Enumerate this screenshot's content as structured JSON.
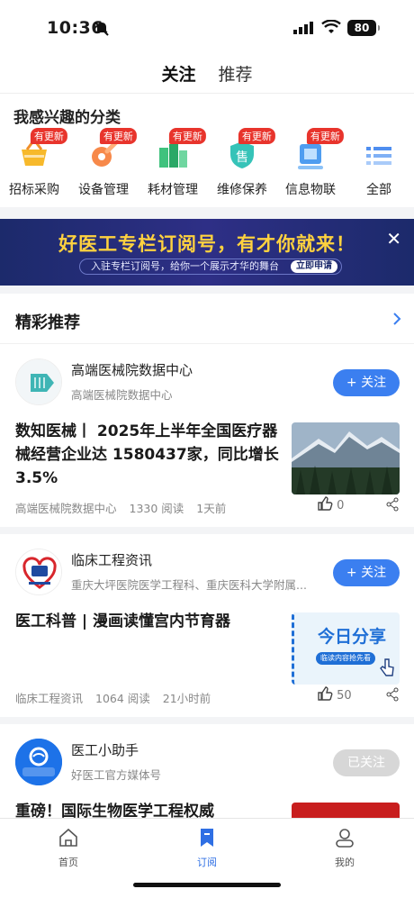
{
  "status_bar": {
    "time": "10:36",
    "battery": "80"
  },
  "top_tabs": {
    "follow": "关注",
    "recommend": "推荐"
  },
  "categories": {
    "title": "我感兴趣的分类",
    "badge": "有更新",
    "items": [
      {
        "label": "招标采购",
        "icon": "basket-icon",
        "badge": true
      },
      {
        "label": "设备管理",
        "icon": "wrench-gear-icon",
        "badge": true
      },
      {
        "label": "耗材管理",
        "icon": "boxes-icon",
        "badge": true
      },
      {
        "label": "维修保养",
        "icon": "repair-shield-icon",
        "badge": true
      },
      {
        "label": "信息物联",
        "icon": "iot-chip-icon",
        "badge": true
      },
      {
        "label": "全部",
        "icon": "list-icon",
        "badge": false
      }
    ]
  },
  "banner": {
    "title": "好医工专栏订阅号，有才你就来！",
    "subtitle": "入驻专栏订阅号，给你一个展示才华的舞台",
    "cta": "立即申请"
  },
  "feed": {
    "title": "精彩推荐",
    "cards": [
      {
        "author": "高端医械院数据中心",
        "author_desc": "高端医械院数据中心",
        "follow_label": "+ 关注",
        "title": "数知医械丨 2025年上半年全国医疗器械经营企业达 1580437家，同比增长 3.5%",
        "source": "高端医械院数据中心",
        "reads": "1330 阅读",
        "time": "1天前",
        "likes": "0"
      },
      {
        "author": "临床工程资讯",
        "author_desc": "重庆大坪医院医学工程科、重庆医科大学附属...",
        "follow_label": "+ 关注",
        "title": "医工科普 | 漫画读懂宫内节育器",
        "thumb_text": "今日分享",
        "thumb_sub": "临读内容抢先看",
        "source": "临床工程资讯",
        "reads": "1064 阅读",
        "time": "21小时前",
        "likes": "50"
      },
      {
        "author": "医工小助手",
        "author_desc": "好医工官方媒体号",
        "follow_label": "已关注",
        "title": "重磅！国际生物医学工程权威"
      }
    ]
  },
  "bottom_nav": {
    "home": "首页",
    "subscribe": "订阅",
    "mine": "我的"
  },
  "colors": {
    "accent": "#3b7ff0",
    "badge_red": "#e8342c",
    "banner_yellow": "#ffd23f"
  }
}
